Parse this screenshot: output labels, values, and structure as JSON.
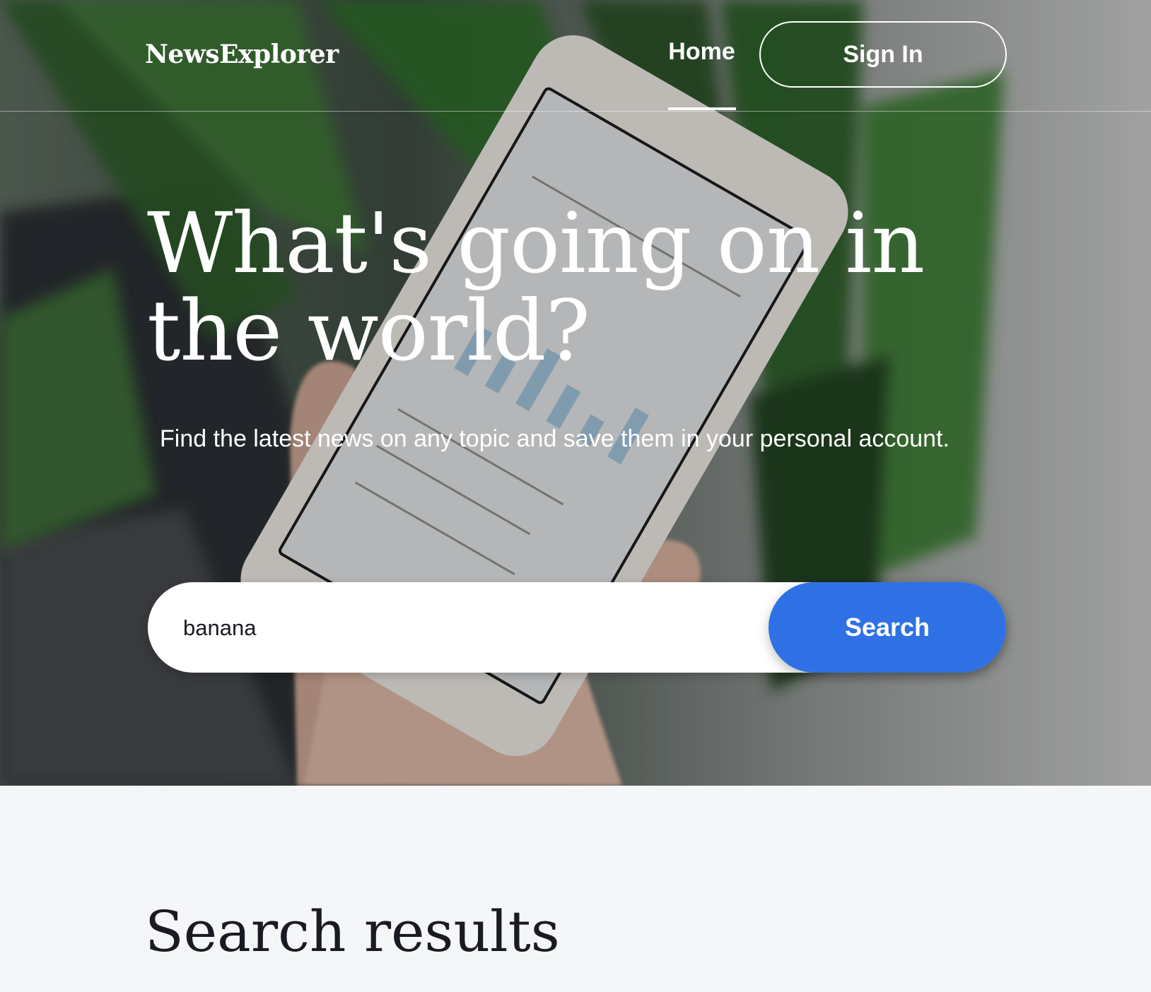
{
  "header": {
    "logo": "NewsExplorer",
    "nav_home": "Home",
    "sign_in": "Sign In"
  },
  "hero": {
    "headline": "What's going on in the world?",
    "subtitle": "Find the latest news on any topic and save them in your personal account."
  },
  "search": {
    "value": "banana",
    "button_label": "Search"
  },
  "results": {
    "title": "Search results"
  },
  "colors": {
    "accent": "#2f71e5",
    "results_background": "#f5f6f7",
    "text_dark": "#1a1b22"
  }
}
